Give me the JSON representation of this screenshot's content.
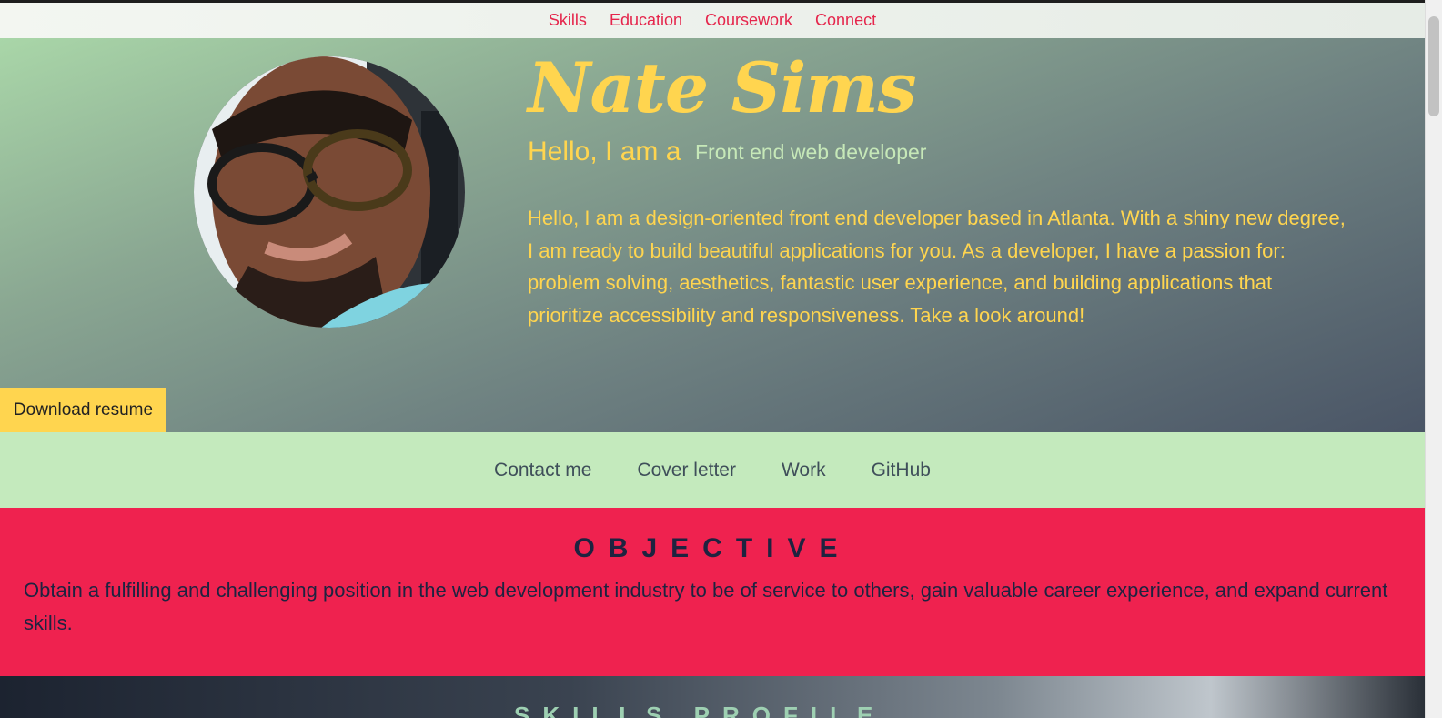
{
  "nav": {
    "items": [
      "Skills",
      "Education",
      "Coursework",
      "Connect"
    ]
  },
  "hero": {
    "name": "Nate Sims",
    "hello": "Hello, I am a",
    "role": "Front end web developer",
    "bio": "Hello, I am a design-oriented front end developer based in Atlanta. With a shiny new degree, I am ready to build beautiful applications for you. As a developer, I have a passion for: problem solving, aesthetics, fantastic user experience, and building applications that prioritize accessibility and responsiveness. Take a look around!",
    "resume_button": "Download resume"
  },
  "links": {
    "items": [
      "Contact me",
      "Cover letter",
      "Work",
      "GitHub"
    ]
  },
  "objective": {
    "title": "OBJECTIVE",
    "text": "Obtain a fulfilling and challenging position in the web development industry to be of service to others, gain valuable career experience, and expand current skills."
  },
  "next_section": {
    "title": "SKILLS PROFILE"
  },
  "colors": {
    "accent_red": "#ef224f",
    "accent_yellow": "#ffd54f",
    "light_green": "#c4eabd",
    "nav_link": "#e5264c"
  }
}
